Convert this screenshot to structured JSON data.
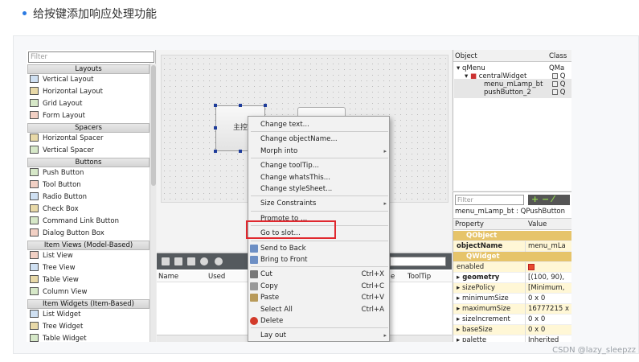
{
  "heading": "给按键添加响应处理功能",
  "credit": "CSDN @lazy_sleepzz",
  "widget_box": {
    "filter_placeholder": "Filter",
    "sections": [
      {
        "title": "Layouts",
        "items": [
          "Vertical Layout",
          "Horizontal Layout",
          "Grid Layout",
          "Form Layout"
        ]
      },
      {
        "title": "Spacers",
        "items": [
          "Horizontal Spacer",
          "Vertical Spacer"
        ]
      },
      {
        "title": "Buttons",
        "items": [
          "Push Button",
          "Tool Button",
          "Radio Button",
          "Check Box",
          "Command Link Button",
          "Dialog Button Box"
        ]
      },
      {
        "title": "Item Views (Model-Based)",
        "items": [
          "List View",
          "Tree View",
          "Table View",
          "Column View"
        ]
      },
      {
        "title": "Item Widgets (Item-Based)",
        "items": [
          "List Widget",
          "Tree Widget",
          "Table Widget"
        ]
      }
    ]
  },
  "form": {
    "button_label": "主控"
  },
  "lower_pane": {
    "columns": [
      "Name",
      "Used",
      "e",
      "ToolTip"
    ]
  },
  "object_inspector": {
    "headers": [
      "Object",
      "Class"
    ],
    "rows": [
      {
        "name": "qMenu",
        "class": "QMa"
      },
      {
        "name": "centralWidget",
        "class": "Q"
      },
      {
        "name": "menu_mLamp_bt",
        "class": "Q"
      },
      {
        "name": "pushButton_2",
        "class": "Q"
      }
    ]
  },
  "property_editor": {
    "filter_placeholder": "Filter",
    "object_line": "menu_mLamp_bt : QPushButton",
    "headers": [
      "Property",
      "Value"
    ],
    "rows": [
      {
        "name": "QObject",
        "value": "",
        "type": "group"
      },
      {
        "name": "objectName",
        "value": "menu_mLa",
        "type": "bold"
      },
      {
        "name": "QWidget",
        "value": "",
        "type": "group"
      },
      {
        "name": "enabled",
        "value": "",
        "type": "check"
      },
      {
        "name": "▸ geometry",
        "value": "[(100, 90),",
        "type": "bold"
      },
      {
        "name": "▸ sizePolicy",
        "value": "[Minimum,",
        "type": "normal"
      },
      {
        "name": "▸ minimumSize",
        "value": "0 x 0",
        "type": "normal"
      },
      {
        "name": "▸ maximumSize",
        "value": "16777215 x",
        "type": "normal"
      },
      {
        "name": "▸ sizeIncrement",
        "value": "0 x 0",
        "type": "normal"
      },
      {
        "name": "▸ baseSize",
        "value": "0 x 0",
        "type": "normal"
      },
      {
        "name": "▸ palette",
        "value": "Inherited",
        "type": "normal"
      }
    ]
  },
  "context_menu": {
    "items": [
      {
        "label": "Change text...",
        "shortcut": "",
        "submenu": false,
        "sep_before": false
      },
      {
        "label": "Change objectName...",
        "shortcut": "",
        "submenu": false,
        "sep_before": true
      },
      {
        "label": "Morph into",
        "shortcut": "",
        "submenu": true,
        "sep_before": false
      },
      {
        "label": "Change toolTip...",
        "shortcut": "",
        "submenu": false,
        "sep_before": true
      },
      {
        "label": "Change whatsThis...",
        "shortcut": "",
        "submenu": false,
        "sep_before": false
      },
      {
        "label": "Change styleSheet...",
        "shortcut": "",
        "submenu": false,
        "sep_before": false
      },
      {
        "label": "Size Constraints",
        "shortcut": "",
        "submenu": true,
        "sep_before": true
      },
      {
        "label": "Promote to ...",
        "shortcut": "",
        "submenu": false,
        "sep_before": true
      },
      {
        "label": "Go to slot...",
        "shortcut": "",
        "submenu": false,
        "sep_before": true,
        "highlighted": true
      },
      {
        "label": "Send to Back",
        "shortcut": "",
        "submenu": false,
        "sep_before": true
      },
      {
        "label": "Bring to Front",
        "shortcut": "",
        "submenu": false,
        "sep_before": false
      },
      {
        "label": "Cut",
        "shortcut": "Ctrl+X",
        "submenu": false,
        "sep_before": true
      },
      {
        "label": "Copy",
        "shortcut": "Ctrl+C",
        "submenu": false,
        "sep_before": false
      },
      {
        "label": "Paste",
        "shortcut": "Ctrl+V",
        "submenu": false,
        "sep_before": false
      },
      {
        "label": "Select All",
        "shortcut": "Ctrl+A",
        "submenu": false,
        "sep_before": false
      },
      {
        "label": "Delete",
        "shortcut": "",
        "submenu": false,
        "sep_before": false
      },
      {
        "label": "Lay out",
        "shortcut": "",
        "submenu": true,
        "sep_before": true
      }
    ]
  },
  "colors": {
    "highlight_box": "#e0282e",
    "property_group": "#e6c46a",
    "accent": "#2a7ae2"
  }
}
